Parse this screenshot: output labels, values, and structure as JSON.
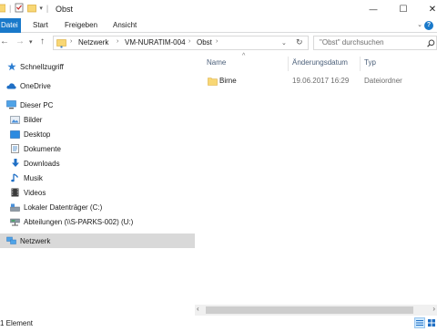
{
  "window": {
    "title": "Obst",
    "minimize_glyph": "—",
    "maximize_glyph": "☐",
    "close_glyph": "✕"
  },
  "ribbon": {
    "tabs": [
      "Datei",
      "Start",
      "Freigeben",
      "Ansicht"
    ]
  },
  "address": {
    "crumbs": [
      "Netzwerk",
      "VM-NURATIM-004",
      "Obst"
    ],
    "search_placeholder": "\"Obst\" durchsuchen"
  },
  "nav": {
    "items": [
      {
        "label": "Schnellzugriff",
        "icon": "star-icon"
      },
      {
        "label": "OneDrive",
        "icon": "cloud-icon"
      },
      {
        "label": "Dieser PC",
        "icon": "computer-icon"
      },
      {
        "label": "Bilder",
        "icon": "pictures-icon"
      },
      {
        "label": "Desktop",
        "icon": "desktop-icon"
      },
      {
        "label": "Dokumente",
        "icon": "documents-icon"
      },
      {
        "label": "Downloads",
        "icon": "download-icon"
      },
      {
        "label": "Musik",
        "icon": "music-icon"
      },
      {
        "label": "Videos",
        "icon": "video-icon"
      },
      {
        "label": "Lokaler Datenträger (C:)",
        "icon": "drive-icon"
      },
      {
        "label": "Abteilungen (\\\\S-PARKS-002) (U:)",
        "icon": "network-drive-icon"
      },
      {
        "label": "Netzwerk",
        "icon": "network-icon"
      }
    ]
  },
  "content": {
    "columns": {
      "name": "Name",
      "date": "Änderungsdatum",
      "type": "Typ"
    },
    "rows": [
      {
        "name": "Birne",
        "date": "19.06.2017 16:29",
        "type": "Dateiordner",
        "icon": "folder-icon"
      }
    ]
  },
  "status": {
    "count": "1 Element"
  },
  "colors": {
    "accent": "#1979ca",
    "folder": "#f8d775",
    "selected_bg": "#d9d9d9"
  }
}
